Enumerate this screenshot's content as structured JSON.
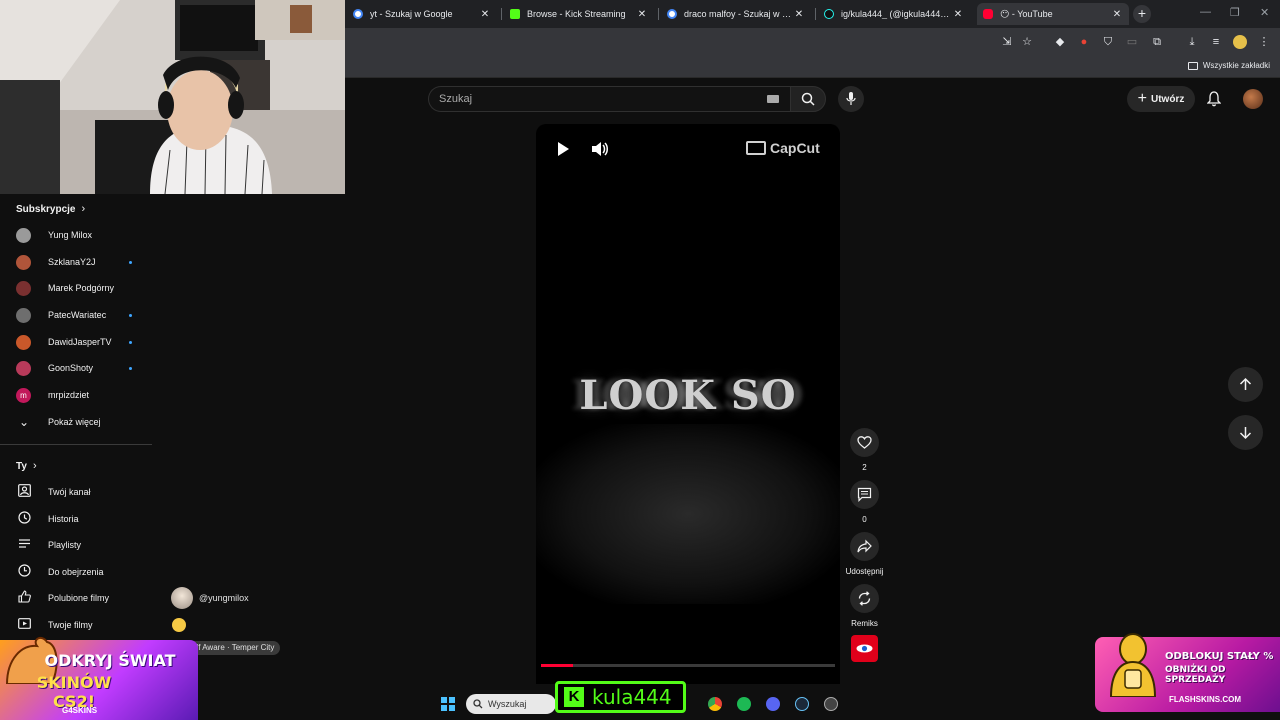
{
  "browser": {
    "tabs": [
      {
        "title": "yt - Szukaj w Google",
        "favicon": "google-icon",
        "active": false
      },
      {
        "title": "Browse - Kick Streaming",
        "favicon": "kick-icon",
        "active": false
      },
      {
        "title": "draco malfoy - Szukaj w Google",
        "favicon": "google-icon",
        "active": false
      },
      {
        "title": "ig/kula444_ (@igkula444_) | TikTok",
        "favicon": "tiktok-icon",
        "active": false
      },
      {
        "title": "😶 - YouTube",
        "favicon": "youtube-icon",
        "active": true
      }
    ],
    "bookmarks_all": "Wszystkie zakładki"
  },
  "youtube": {
    "search_placeholder": "Szukaj",
    "create_label": "Utwórz"
  },
  "sidebar": {
    "subscriptions_title": "Subskrypcje",
    "subscriptions": [
      {
        "name": "Yung Milox",
        "new": false,
        "color": "#9a9a9a",
        "initial": ""
      },
      {
        "name": "SzklanaY2J",
        "new": true,
        "color": "#b0553a",
        "initial": ""
      },
      {
        "name": "Marek Podgórny",
        "new": false,
        "color": "#7a3030",
        "initial": ""
      },
      {
        "name": "PatecWariatec",
        "new": true,
        "color": "#6e6e6e",
        "initial": ""
      },
      {
        "name": "DawidJasperTV",
        "new": true,
        "color": "#c9582a",
        "initial": ""
      },
      {
        "name": "GoonShoty",
        "new": true,
        "color": "#b83a5a",
        "initial": ""
      },
      {
        "name": "mrpizdziet",
        "new": false,
        "color": "#c2185b",
        "initial": "m"
      }
    ],
    "show_more": "Pokaż więcej",
    "you_title": "Ty",
    "you_items": [
      {
        "label": "Twój kanał",
        "icon": "channel-icon"
      },
      {
        "label": "Historia",
        "icon": "history-icon"
      },
      {
        "label": "Playlisty",
        "icon": "playlist-icon"
      },
      {
        "label": "Do obejrzenia",
        "icon": "watch-later-icon"
      },
      {
        "label": "Polubione filmy",
        "icon": "like-icon"
      },
      {
        "label": "Twoje filmy",
        "icon": "video-icon"
      }
    ]
  },
  "short": {
    "overlay_text": "LOOK SO",
    "watermark": "CapCut",
    "progress": 0.11,
    "likes": "2",
    "comments": "0",
    "share_label": "Udostępnij",
    "remix_label": "Remiks",
    "channel_handle": "@yungmilox",
    "song": "elf Aware · Temper City"
  },
  "overlays": {
    "ad_left_line1": "ODKRYJ ŚWIAT",
    "ad_left_line2": "SKINÓW CS2!",
    "ad_left_brand": "G4SKINS",
    "ad_right_line1": "ODBLOKUJ STAŁY %",
    "ad_right_line2": "OBNIŻKI OD SPRZEDAŻY",
    "ad_right_brand": "FLASHSKINS.COM",
    "kick_name": "kula444"
  },
  "taskbar": {
    "search_placeholder": "Wyszukaj"
  },
  "colors": {
    "yt_bg": "#0f0f0f",
    "accent_red": "#ff0033",
    "kick_green": "#53fc18",
    "new_dot": "#3ea6ff"
  }
}
